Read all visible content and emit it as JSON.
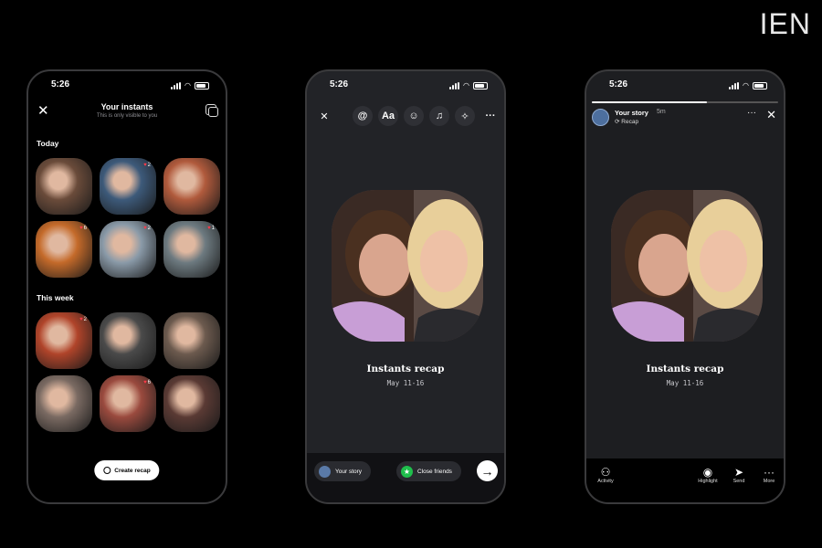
{
  "watermark": "IEN",
  "status_time": "5:26",
  "phone1": {
    "title": "Your instants",
    "subtitle": "This is only visible to you",
    "section_today": "Today",
    "section_week": "This week",
    "create_button": "Create recap",
    "today_badges": [
      "",
      "2",
      "",
      "6",
      "2",
      "1"
    ],
    "week_badges": [
      "2",
      "",
      "",
      "",
      "6",
      ""
    ],
    "colors": {
      "today": [
        "#6a4b3a",
        "#3d5a7a",
        "#b05a3c",
        "#c46a2a",
        "#8a9aa8",
        "#6d7a80"
      ],
      "week": [
        "#b0442a",
        "#4a4a4a",
        "#6c5a4e",
        "#7a6a62",
        "#9a4a3e",
        "#5a3a34"
      ]
    }
  },
  "phone2": {
    "recap_title": "Instants recap",
    "recap_date": "May 11-16",
    "toolbar_text": "Aa",
    "your_story": "Your story",
    "close_friends": "Close friends"
  },
  "phone3": {
    "story_name": "Your story",
    "story_time": "5m",
    "story_sub": "Recap",
    "recap_title": "Instants recap",
    "recap_date": "May 11-16",
    "progress": 0.62,
    "actions": {
      "activity": "Activity",
      "highlight": "Highlight",
      "send": "Send",
      "more": "More"
    }
  }
}
